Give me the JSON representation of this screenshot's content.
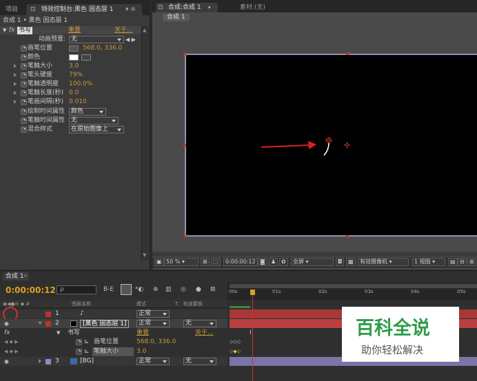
{
  "left_panel": {
    "tab_project": "项目",
    "tab_effect_controls": "特效控制台:黑色 固态层 1",
    "breadcrumb": "合成 1 • 黑色 固态层 1",
    "effect": {
      "fx": "fx",
      "name": "书写",
      "reset": "重置",
      "about": "关于..."
    },
    "props": [
      {
        "label": "动画预置:",
        "dropdown": "无"
      },
      {
        "label": "画笔位置",
        "value": "568.0, 336.0"
      },
      {
        "label": "颜色"
      },
      {
        "label": "笔触大小",
        "value": "3.0"
      },
      {
        "label": "笔头硬度",
        "value": "79%"
      },
      {
        "label": "笔触透明度",
        "value": "100.0%"
      },
      {
        "label": "笔触长度(秒)",
        "value": "0.0"
      },
      {
        "label": "笔画间隔(秒)",
        "value": "0.010"
      },
      {
        "label": "绘制时间属性",
        "dropdown": "颜色"
      },
      {
        "label": "笔触时间属性",
        "dropdown": "无"
      },
      {
        "label": "混合样式",
        "dropdown": "在原始图像上"
      }
    ]
  },
  "viewer": {
    "tab_comp": "合成:合成 1",
    "tab_footage": "素材:(无)",
    "subtab": "合成 1",
    "toolbar": {
      "zoom": "50 %",
      "timecode": "0:00:00:12",
      "resolution": "全屏",
      "camera": "有效摄像机",
      "views": "1 视图"
    }
  },
  "timeline": {
    "tab": "合成 1",
    "timecode": "0:00:00:12",
    "search_placeholder": "ρ",
    "ticks": [
      "00s",
      "01s",
      "02s",
      "03s",
      "04s",
      "05s"
    ],
    "headers": {
      "name": "图层名称",
      "mode": "模式",
      "t": "T",
      "trkmat": "轨道蒙板"
    },
    "layers": [
      {
        "num": "1",
        "name": "♪",
        "mode": "正常"
      },
      {
        "num": "2",
        "name": "[黑色 固态层 1]",
        "mode": "正常",
        "trkmat": "无"
      },
      {
        "effect": "书写",
        "reset": "重置",
        "about": "关于..."
      },
      {
        "prop": "画笔位置",
        "value": "568.0, 336.0"
      },
      {
        "prop": "笔触大小",
        "value": "3.0"
      },
      {
        "num": "3",
        "name": "[BG]",
        "mode": "正常",
        "trkmat": "无"
      }
    ]
  },
  "watermark": {
    "title": "百科全说",
    "sub": "助你轻松解决"
  }
}
